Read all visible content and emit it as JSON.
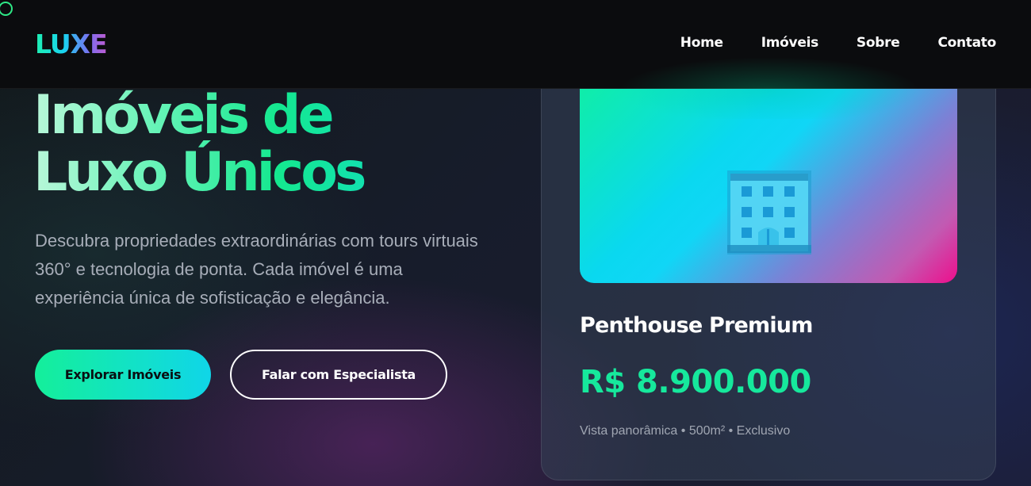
{
  "header": {
    "logo": "LUXE",
    "nav": [
      "Home",
      "Imóveis",
      "Sobre",
      "Contato"
    ]
  },
  "hero": {
    "title_line1": "Imóveis de",
    "title_line2": "Luxo Únicos",
    "description": "Descubra propriedades extraordinárias com tours virtuais 360° e tecnologia de ponta. Cada imóvel é uma experiência única de sofisticação e elegância.",
    "primary_button": "Explorar Imóveis",
    "secondary_button": "Falar com Especialista"
  },
  "card": {
    "image_icon": "building-icon",
    "title": "Penthouse Premium",
    "price": "R$ 8.900.000",
    "features": "Vista panorâmica • 500m² • Exclusivo"
  },
  "colors": {
    "accent": "#16e89c",
    "accent_cyan": "#10d5e8",
    "accent_pink": "#ee0e8c",
    "header_bg": "#0b0c0e"
  }
}
